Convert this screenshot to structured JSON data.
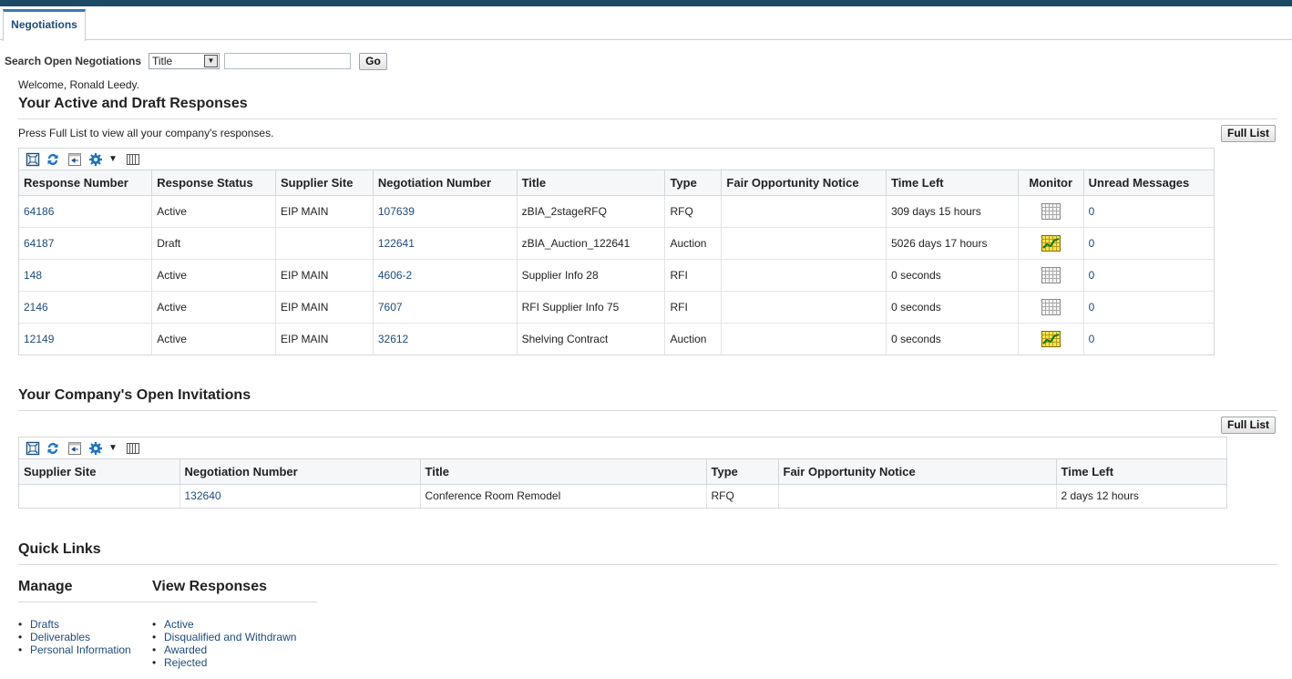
{
  "tabs": [
    {
      "label": "Negotiations",
      "active": true
    }
  ],
  "search": {
    "label": "Search Open Negotiations",
    "select_value": "Title",
    "input_value": "",
    "go_label": "Go"
  },
  "welcome": "Welcome, Ronald Leedy.",
  "responses": {
    "title": "Your Active and Draft Responses",
    "hint": "Press Full List to view all your company's responses.",
    "full_list_label": "Full List",
    "toolbar_icons": [
      "detach-icon",
      "refresh-icon",
      "reset-icon",
      "settings-icon",
      "columns-icon"
    ],
    "columns": [
      "Response Number",
      "Response Status",
      "Supplier Site",
      "Negotiation Number",
      "Title",
      "Type",
      "Fair Opportunity Notice",
      "Time Left",
      "Monitor",
      "Unread Messages"
    ],
    "rows": [
      {
        "response_number": "64186",
        "status": "Active",
        "site": "EIP MAIN",
        "negotiation": "107639",
        "title": "zBIA_2stageRFQ",
        "type": "RFQ",
        "notice": "",
        "time_left": "309 days 15 hours",
        "monitor": "monitor-grid-icon",
        "unread": "0"
      },
      {
        "response_number": "64187",
        "status": "Draft",
        "site": "",
        "negotiation": "122641",
        "title": "zBIA_Auction_122641",
        "type": "Auction",
        "notice": "",
        "time_left": "5026 days 17 hours",
        "monitor": "monitor-chart-icon",
        "unread": "0"
      },
      {
        "response_number": "148",
        "status": "Active",
        "site": "EIP MAIN",
        "negotiation": "4606-2",
        "title": "Supplier Info 28",
        "type": "RFI",
        "notice": "",
        "time_left": "0 seconds",
        "monitor": "monitor-grid-icon",
        "unread": "0"
      },
      {
        "response_number": "2146",
        "status": "Active",
        "site": "EIP MAIN",
        "negotiation": "7607",
        "title": "RFI Supplier Info 75",
        "type": "RFI",
        "notice": "",
        "time_left": "0 seconds",
        "monitor": "monitor-grid-icon",
        "unread": "0"
      },
      {
        "response_number": "12149",
        "status": "Active",
        "site": "EIP MAIN",
        "negotiation": "32612",
        "title": "Shelving Contract",
        "type": "Auction",
        "notice": "",
        "time_left": "0 seconds",
        "monitor": "monitor-chart-icon",
        "unread": "0"
      }
    ]
  },
  "invitations": {
    "title": "Your Company's Open Invitations",
    "full_list_label": "Full List",
    "columns": [
      "Supplier Site",
      "Negotiation Number",
      "Title",
      "Type",
      "Fair Opportunity Notice",
      "Time Left"
    ],
    "rows": [
      {
        "site": "",
        "negotiation": "132640",
        "title": "Conference Room Remodel",
        "type": "RFQ",
        "notice": "",
        "time_left": "2 days 12 hours"
      }
    ]
  },
  "quick_links": {
    "title": "Quick Links",
    "manage": {
      "heading": "Manage",
      "items": [
        "Drafts",
        "Deliverables",
        "Personal Information"
      ]
    },
    "view_responses": {
      "heading": "View Responses",
      "items": [
        "Active",
        "Disqualified and Withdrawn",
        "Awarded",
        "Rejected"
      ]
    }
  },
  "colors": {
    "top_bar": "#1c4a65",
    "tab_accent": "#3a7bb7",
    "link": "#1f4b7a",
    "icon_blue": "#1a63a9"
  }
}
